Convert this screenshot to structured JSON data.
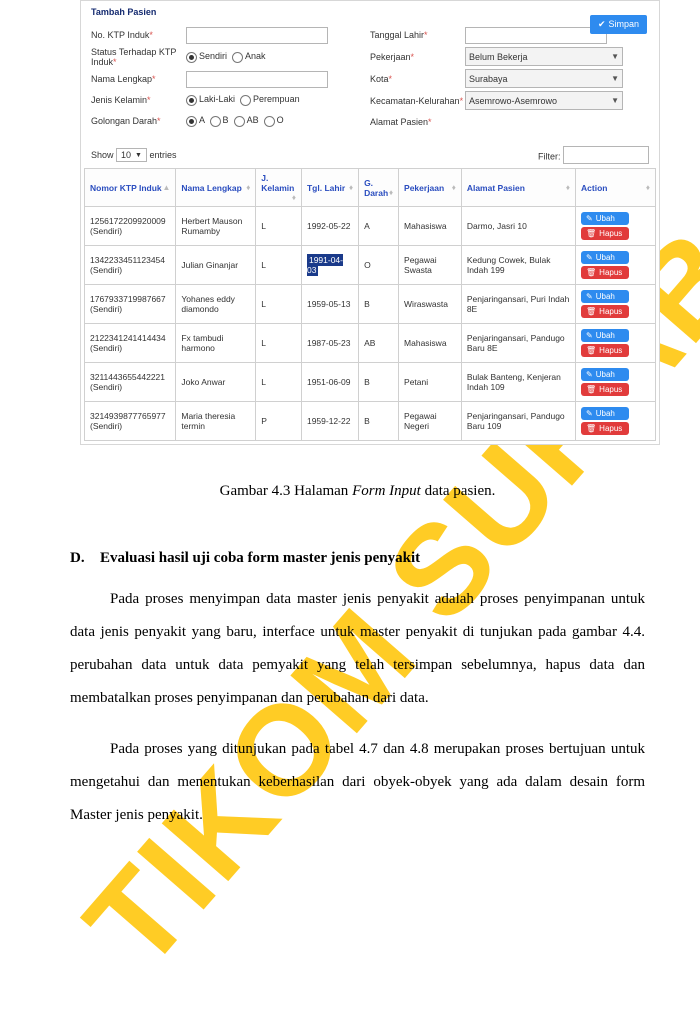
{
  "form": {
    "title": "Tambah Pasien",
    "simpan": "Simpan",
    "left": {
      "noktp_label": "No. KTP Induk",
      "status_label": "Status Terhadap KTP Induk",
      "sendiri": "Sendiri",
      "anak": "Anak",
      "nama_label": "Nama Lengkap",
      "jk_label": "Jenis Kelamin",
      "laki": "Laki-Laki",
      "perempuan": "Perempuan",
      "gol_label": "Golongan Darah",
      "golA": "A",
      "golB": "B",
      "golAB": "AB",
      "golO": "O"
    },
    "right": {
      "tgl_label": "Tanggal Lahir",
      "pekerjaan_label": "Pekerjaan",
      "pekerjaan_val": "Belum Bekerja",
      "kota_label": "Kota",
      "kota_val": "Surabaya",
      "kec_label": "Kecamatan-Kelurahan",
      "kec_val": "Asemrowo-Asemrowo",
      "alamat_label": "Alamat Pasien"
    }
  },
  "table_ctl": {
    "show": "Show",
    "count": "10",
    "entries": "entries",
    "filter": "Filter:"
  },
  "headers": {
    "ktp": "Nomor KTP Induk",
    "nama": "Nama Lengkap",
    "jk": "J. Kelamin",
    "tgl": "Tgl. Lahir",
    "gd": "G. Darah",
    "pek": "Pekerjaan",
    "alamat": "Alamat Pasien",
    "action": "Action"
  },
  "rows": [
    {
      "ktp": "1256172209920009",
      "st": "(Sendiri)",
      "nama": "Herbert Mauson Rumamby",
      "jk": "L",
      "tgl": "1992-05-22",
      "tgl_hl": false,
      "gd": "A",
      "pek": "Mahasiswa",
      "alamat": "Darmo, Jasri 10"
    },
    {
      "ktp": "1342233451123454",
      "st": "(Sendiri)",
      "nama": "Julian Ginanjar",
      "jk": "L",
      "tgl": "1991-04-03",
      "tgl_hl": true,
      "gd": "O",
      "pek": "Pegawai Swasta",
      "alamat": "Kedung Cowek, Bulak Indah 199"
    },
    {
      "ktp": "1767933719987667",
      "st": "(Sendiri)",
      "nama": "Yohanes eddy diamondo",
      "jk": "L",
      "tgl": "1959-05-13",
      "tgl_hl": false,
      "gd": "B",
      "pek": "Wiraswasta",
      "alamat": "Penjaringansari, Puri Indah 8E"
    },
    {
      "ktp": "2122341241414434",
      "st": "(Sendiri)",
      "nama": "Fx tambudi harmono",
      "jk": "L",
      "tgl": "1987-05-23",
      "tgl_hl": false,
      "gd": "AB",
      "pek": "Mahasiswa",
      "alamat": "Penjaringansari, Pandugo Baru 8E"
    },
    {
      "ktp": "3211443655442221",
      "st": "(Sendiri)",
      "nama": "Joko Anwar",
      "jk": "L",
      "tgl": "1951-06-09",
      "tgl_hl": false,
      "gd": "B",
      "pek": "Petani",
      "alamat": "Bulak Banteng, Kenjeran Indah 109"
    },
    {
      "ktp": "3214939877765977",
      "st": "(Sendiri)",
      "nama": "Maria theresia termin",
      "jk": "P",
      "tgl": "1959-12-22",
      "tgl_hl": false,
      "gd": "B",
      "pek": "Pegawai Negeri",
      "alamat": "Penjaringansari, Pandugo Baru 109"
    }
  ],
  "action": {
    "ubah": "Ubah",
    "hapus": "Hapus"
  },
  "caption": {
    "pre": "Gambar 4.3  Halaman ",
    "it": "Form Input",
    "post": " data pasien."
  },
  "doc": {
    "heading_letter": "D.",
    "heading": "Evaluasi hasil uji coba form master jenis penyakit",
    "p1": "Pada  proses menyimpan data master  jenis penyakit adalah proses penyimpanan untuk  data jenis penyakit yang baru, interface untuk master penyakit di tunjukan pada gambar 4.4.  perubahan data untuk data pemyakit yang telah tersimpan sebelumnya, hapus data dan membatalkan proses penyimpanan dan perubahan dari data.",
    "p2": "Pada  proses yang ditunjukan pada tabel 4.7 dan 4.8 merupakan  proses bertujuan untuk mengetahui dan menentukan keberhasilan dari obyek-obyek yang ada dalam desain form Master jenis penyakit."
  },
  "watermark": "TIKOM SURABAYA"
}
